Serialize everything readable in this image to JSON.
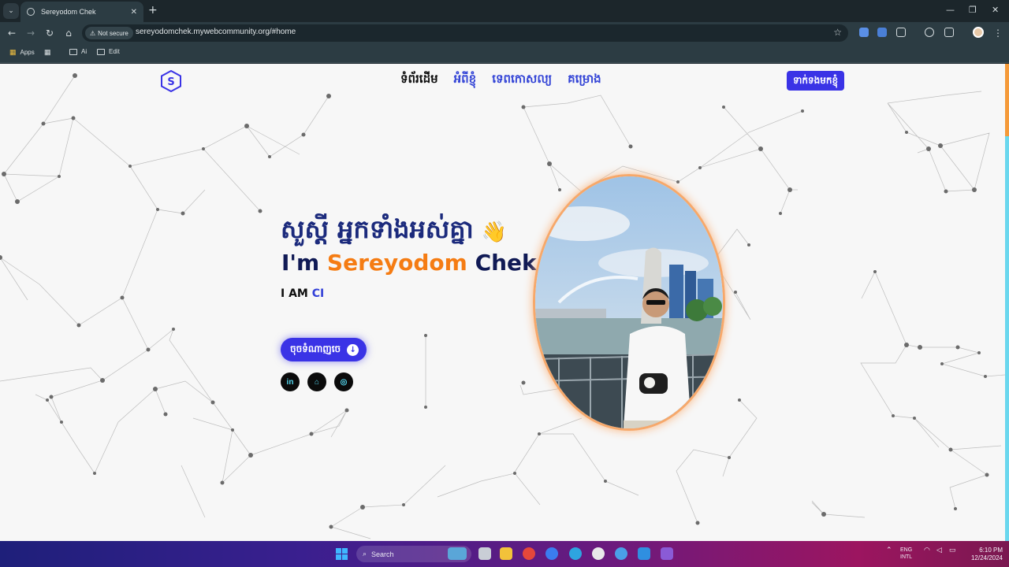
{
  "browser": {
    "tab_title": "Sereyodom Chek",
    "security_label": "Not secure",
    "url": "sereyodomchek.mywebcommunity.org/#home",
    "bookmarks": [
      {
        "label": "Apps",
        "icon": "apps-grid-icon"
      },
      {
        "label": "",
        "icon": "tab-groups-icon"
      },
      {
        "label": "Ai",
        "icon": "folder-icon"
      },
      {
        "label": "Edit",
        "icon": "folder-icon"
      }
    ]
  },
  "site": {
    "logo_letter": "S",
    "nav": [
      {
        "label": "ទំព័រដើម",
        "active": true
      },
      {
        "label": "អំពីខ្ញុំ",
        "active": false
      },
      {
        "label": "ទេពកោសល្យ",
        "active": false
      },
      {
        "label": "គម្រោង",
        "active": false
      }
    ],
    "contact_label": "ទាក់ទងមកខ្ញុំ",
    "accent_color": "#3a33e6",
    "highlight_color": "#f57c13",
    "hero": {
      "greeting": "សួស្តី អ្នកទាំងអស់គ្នា",
      "wave_emoji": "👋",
      "intro_prefix": "I'm ",
      "first_name": "Sereyodom",
      "last_name": " Chek",
      "role_prefix": "I AM ",
      "role_value": "CI",
      "cv_label": "ចុចទំណាញចេ",
      "socials": [
        {
          "icon": "linkedin-icon",
          "glyph": "in"
        },
        {
          "icon": "github-icon",
          "glyph": "⌂"
        },
        {
          "icon": "instagram-icon",
          "glyph": "◎"
        }
      ]
    }
  },
  "taskbar": {
    "search_label": "Search",
    "lang_top": "ENG",
    "lang_bottom": "INTL",
    "time": "6:10 PM",
    "date": "12/24/2024"
  }
}
